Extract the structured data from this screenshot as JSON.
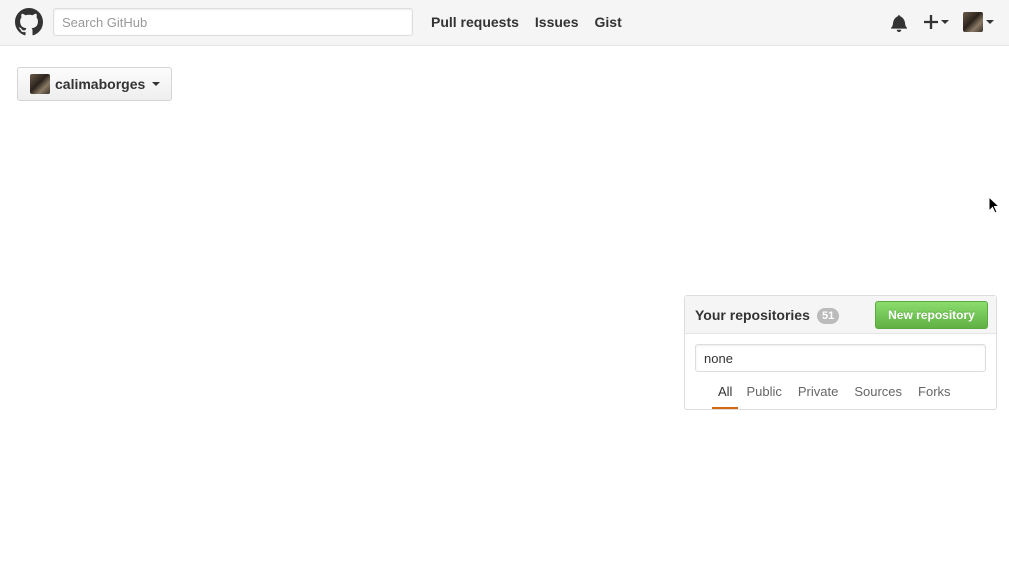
{
  "header": {
    "search_placeholder": "Search GitHub",
    "nav": [
      "Pull requests",
      "Issues",
      "Gist"
    ],
    "icons": [
      "github-logo-icon",
      "bell-icon",
      "plus-icon",
      "avatar"
    ]
  },
  "account": {
    "name": "calimaborges"
  },
  "repositories": {
    "title": "Your repositories",
    "count": "51",
    "new_button": "New repository",
    "filter_value": "none",
    "tabs": [
      "All",
      "Public",
      "Private",
      "Sources",
      "Forks"
    ],
    "selected_tab": "All"
  },
  "colors": {
    "accent_green": "#60b044",
    "tab_underline": "#d26911"
  }
}
